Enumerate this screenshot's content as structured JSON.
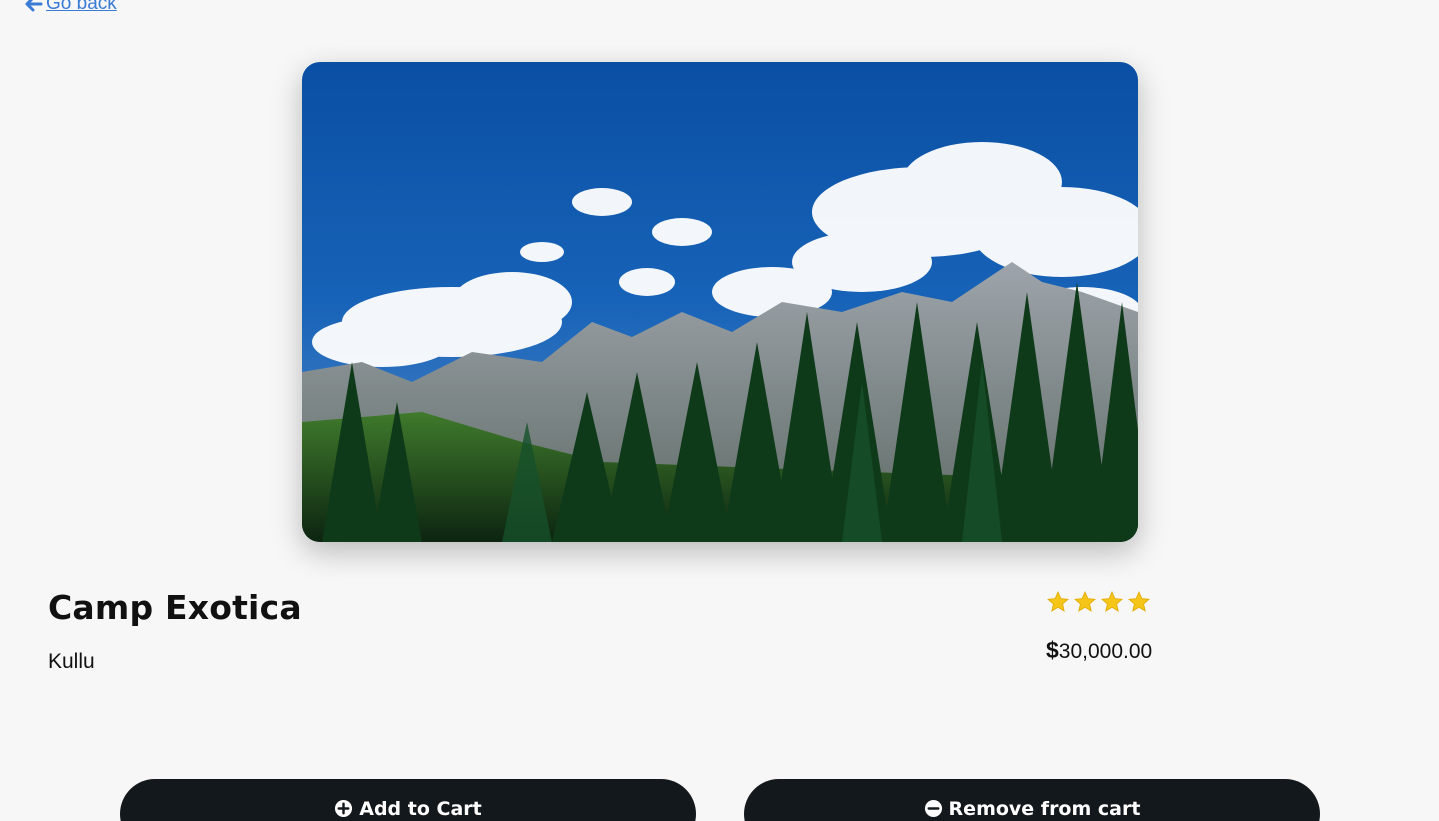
{
  "nav": {
    "back_label": "Go back",
    "link_color": "#3a7bd5"
  },
  "product": {
    "image": {
      "description_icon": "mountain-forest-image"
    },
    "title": "Camp Exotica",
    "location": "Kullu",
    "rating": 4,
    "rating_max": 4,
    "price_currency": "$",
    "price_value": "30,000.00"
  },
  "actions": {
    "add_label": "Add to Cart",
    "remove_label": "Remove from cart",
    "add_icon": "plus-circle-icon",
    "remove_icon": "minus-circle-icon",
    "button_color": "#13181c"
  },
  "colors": {
    "background": "#f7f7f7",
    "star": "#f5c518"
  }
}
